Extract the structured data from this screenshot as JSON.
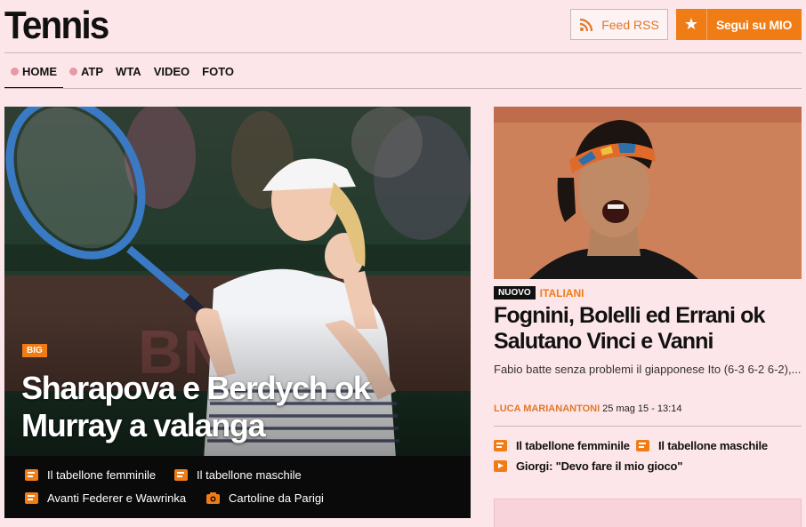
{
  "header": {
    "title": "Tennis",
    "rss_label": "Feed RSS",
    "follow_label": "Segui su MIO"
  },
  "nav": {
    "items": [
      {
        "label": "HOME",
        "dot": true,
        "active": true
      },
      {
        "label": "ATP",
        "dot": true,
        "active": false
      },
      {
        "label": "WTA",
        "dot": false,
        "active": false
      },
      {
        "label": "VIDEO",
        "dot": false,
        "active": false
      },
      {
        "label": "FOTO",
        "dot": false,
        "active": false
      }
    ]
  },
  "hero": {
    "tag": "BIG",
    "headline": "Sharapova e Berdych ok Murray a valanga",
    "links": [
      {
        "label": "Il tabellone femminile",
        "icon": "document-icon"
      },
      {
        "label": "Il tabellone maschile",
        "icon": "document-icon"
      },
      {
        "label": "Avanti Federer e Wawrinka",
        "icon": "document-icon"
      },
      {
        "label": "Cartoline da Parigi",
        "icon": "camera-icon"
      }
    ]
  },
  "side_article": {
    "badge": "NUOVO",
    "category": "ITALIANI",
    "headline": "Fognini, Bolelli ed Errani ok Salutano Vinci e Vanni",
    "summary": "Fabio batte senza problemi il giapponese Ito (6-3 6-2 6-2),...",
    "author": "LUCA MARIANANTONI",
    "date": "25 mag 15 - 13:14",
    "links": [
      {
        "label": "Il tabellone femminile",
        "icon": "document-icon"
      },
      {
        "label": "Il tabellone maschile",
        "icon": "document-icon"
      },
      {
        "label": "Giorgi: \"Devo fare il mio gioco\"",
        "icon": "play-icon"
      }
    ]
  },
  "colors": {
    "background": "#fde6ea",
    "accent": "#f07c16",
    "text": "#111111"
  }
}
